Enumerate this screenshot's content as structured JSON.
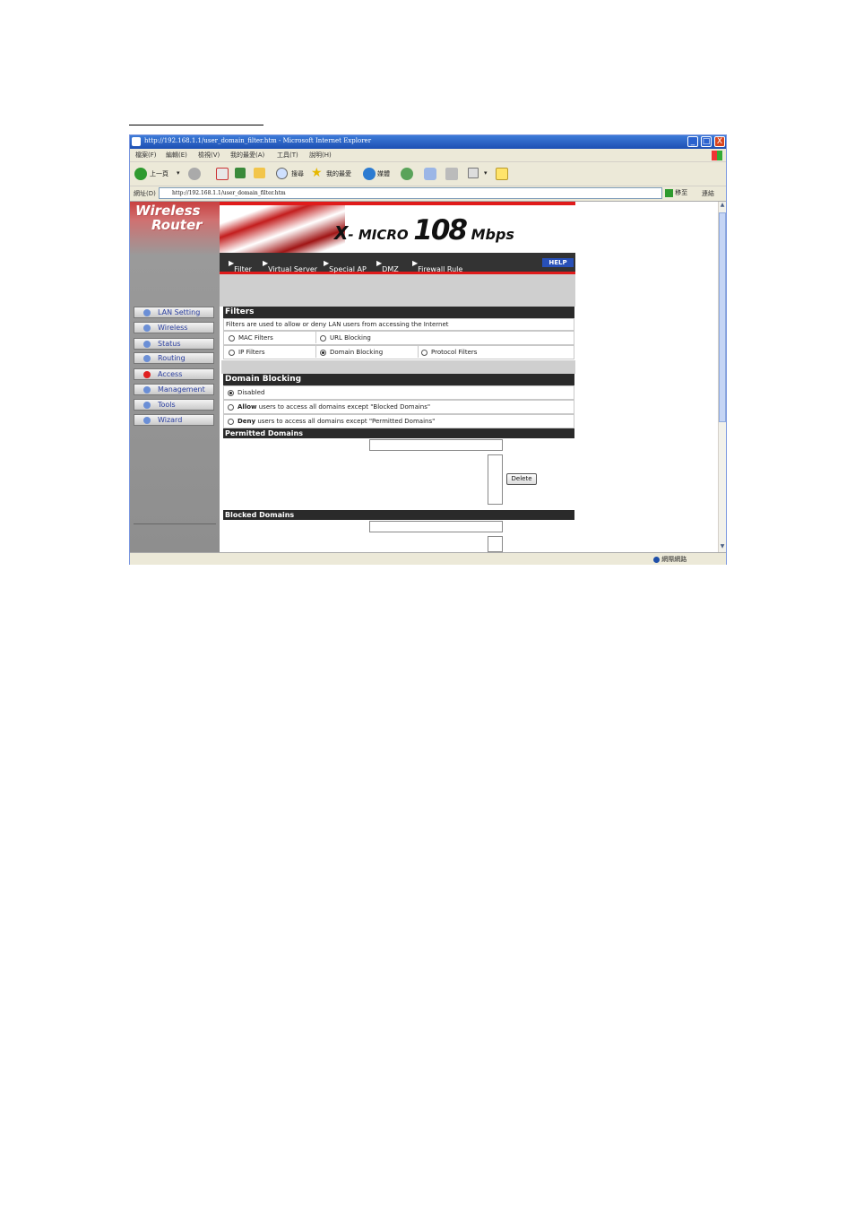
{
  "window": {
    "title": "http://192.168.1.1/user_domain_filter.htm - Microsoft Internet Explorer",
    "controls": {
      "minimize": "_",
      "maximize": "□",
      "close": "X"
    }
  },
  "menu": [
    "檔案(F)",
    "編輯(E)",
    "檢視(V)",
    "我的最愛(A)",
    "工具(T)",
    "說明(H)"
  ],
  "toolbar": {
    "back": "上一頁",
    "search": "搜尋",
    "favorites": "我的最愛",
    "media": "媒體"
  },
  "address": {
    "label": "網址(D)",
    "url": "http://192.168.1.1/user_domain_filter.htm",
    "go": "移至",
    "links": "連結"
  },
  "status": {
    "zone": "網際網路"
  },
  "brand": {
    "line1": "Wireless",
    "line2": "Router"
  },
  "logo": {
    "x": "X",
    "micro": "- MICRO",
    "num": "108",
    "mbps": "Mbps"
  },
  "tabs": [
    "Filter",
    "Virtual Server",
    "Special AP",
    "DMZ",
    "Firewall Rule"
  ],
  "help": "HELP",
  "nav": [
    {
      "label": "LAN Setting"
    },
    {
      "label": "Wireless"
    },
    {
      "label": "Status"
    },
    {
      "label": "Routing"
    },
    {
      "label": "Access"
    },
    {
      "label": "Management"
    },
    {
      "label": "Tools"
    },
    {
      "label": "Wizard"
    }
  ],
  "filters": {
    "title": "Filters",
    "description": "Filters are used to allow or deny LAN users from accessing the Internet",
    "options": {
      "mac": "MAC Filters",
      "url": "URL Blocking",
      "ip": "IP Filters",
      "domain": "Domain Blocking",
      "protocol": "Protocol Filters"
    },
    "selected": "domain"
  },
  "domain_blocking": {
    "title": "Domain Blocking",
    "disabled": "Disabled",
    "allow_bold": "Allow",
    "allow_rest": "users to access all domains except \"Blocked Domains\"",
    "deny_bold": "Deny",
    "deny_rest": "users to access all domains except \"Permitted Domains\"",
    "selected": "disabled"
  },
  "permitted": {
    "title": "Permitted Domains",
    "input_value": "",
    "delete": "Delete"
  },
  "blocked": {
    "title": "Blocked Domains",
    "input_value": ""
  }
}
